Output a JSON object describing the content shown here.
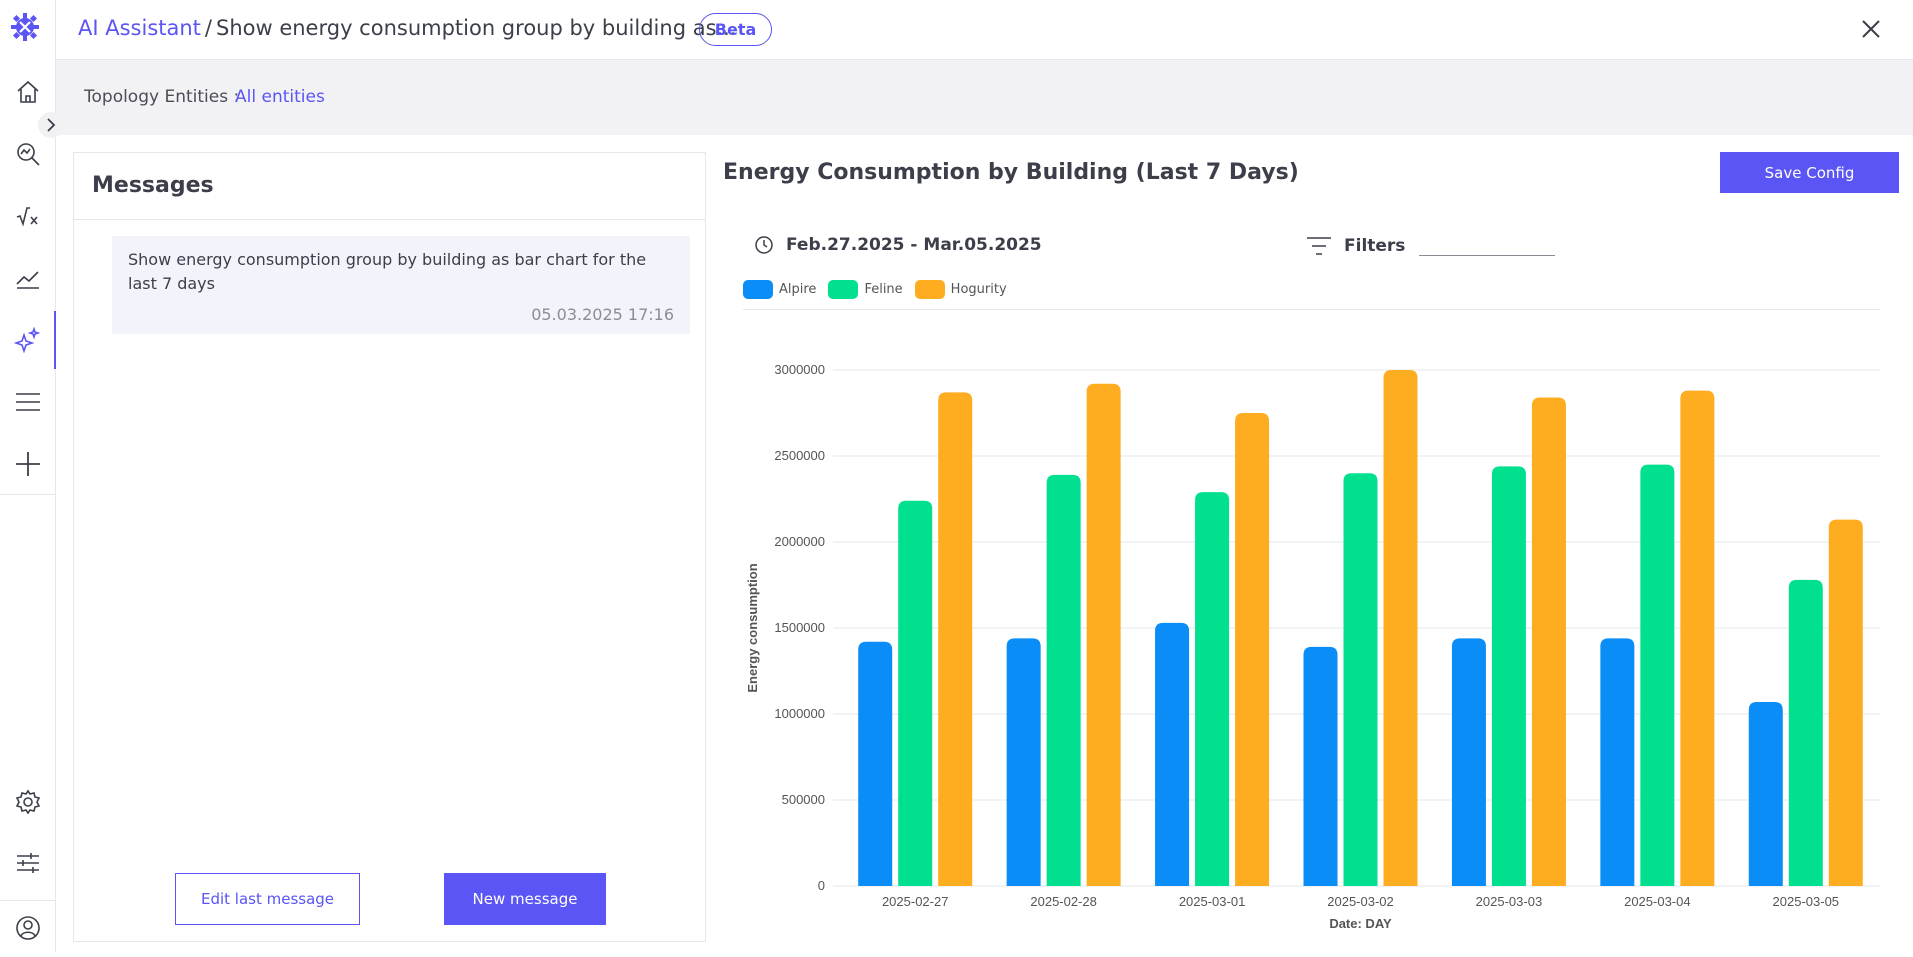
{
  "header": {
    "breadcrumb_root": "AI Assistant",
    "breadcrumb_sep": "/",
    "breadcrumb_current": "Show energy consumption group by building as...",
    "badge": "Beta"
  },
  "topology": {
    "label": "Topology Entities :",
    "value": "All entities"
  },
  "messages": {
    "title": "Messages",
    "items": [
      {
        "text": "Show energy consumption group by building as bar chart for the last 7 days",
        "time": "05.03.2025 17:16"
      }
    ],
    "edit_label": "Edit last message",
    "new_label": "New message"
  },
  "chart_panel": {
    "save_label": "Save Config",
    "date_range": "Feb.27.2025 - Mar.05.2025",
    "filters_label": "Filters"
  },
  "colors": {
    "accent": "#5a55f4",
    "alpire": "#0a8df7",
    "feline": "#00e08f",
    "hogurity": "#fdad1f"
  },
  "chart_data": {
    "type": "bar",
    "title": "Energy Consumption by Building (Last 7 Days)",
    "xlabel": "Date: DAY",
    "ylabel": "Energy consumption",
    "categories": [
      "2025-02-27",
      "2025-02-28",
      "2025-03-01",
      "2025-03-02",
      "2025-03-03",
      "2025-03-04",
      "2025-03-05"
    ],
    "series": [
      {
        "name": "Alpire",
        "color": "#0a8df7",
        "values": [
          1420000,
          1440000,
          1530000,
          1390000,
          1440000,
          1440000,
          1070000
        ]
      },
      {
        "name": "Feline",
        "color": "#00e08f",
        "values": [
          2240000,
          2390000,
          2290000,
          2400000,
          2440000,
          2450000,
          1780000
        ]
      },
      {
        "name": "Hogurity",
        "color": "#fdad1f",
        "values": [
          2870000,
          2920000,
          2750000,
          3000000,
          2840000,
          2880000,
          2130000
        ]
      }
    ],
    "yticks": [
      "0",
      "500000",
      "1000000",
      "1500000",
      "2000000",
      "2500000",
      "3000000"
    ],
    "ylim": [
      0,
      3000000
    ],
    "legend": "top-left",
    "grid": true
  }
}
